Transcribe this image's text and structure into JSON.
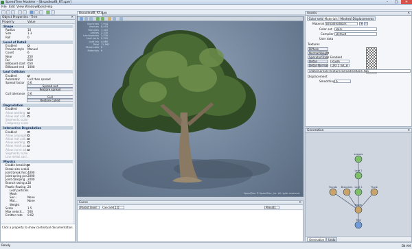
{
  "window": {
    "title": "SpeedTree Modeler - [BroadleafB_RT.spm]"
  },
  "menu": [
    "File",
    "Edit",
    "View",
    "Windows",
    "Tools",
    "Help"
  ],
  "object_properties": {
    "title": "Object Properties - Tree",
    "columns": [
      "Property",
      "Value"
    ],
    "rows": [
      {
        "type": "section",
        "name": "Shape"
      },
      {
        "name": "Radius",
        "value": "10"
      },
      {
        "name": "Size",
        "value": "1.3"
      },
      {
        "name": "Roll",
        "value": "0"
      },
      {
        "type": "gap"
      },
      {
        "type": "section",
        "name": "Level of Detail"
      },
      {
        "name": "Enabled",
        "check": true
      },
      {
        "name": "Preview style",
        "value": "Manual"
      },
      {
        "name": "Count",
        "value": "6"
      },
      {
        "name": "Near",
        "value": "250"
      },
      {
        "name": "Far",
        "value": "650"
      },
      {
        "name": "Billboard start",
        "value": "650"
      },
      {
        "name": "Billboard end",
        "value": "1000"
      },
      {
        "type": "gap"
      },
      {
        "type": "section",
        "name": "Leaf Collision"
      },
      {
        "name": "Enabled",
        "check": true
      },
      {
        "name": "Automatic",
        "value": "Cull then spread"
      },
      {
        "name": "Spread factor",
        "value": "0.6"
      },
      {
        "type": "button",
        "label": "Spread out"
      },
      {
        "type": "button",
        "label": "Restore spread"
      },
      {
        "name": "Cull tolerance",
        "value": "0.6"
      },
      {
        "type": "button",
        "label": "Cull"
      },
      {
        "type": "button",
        "label": "Restore culled"
      },
      {
        "type": "gap"
      },
      {
        "type": "section",
        "name": "Degradation"
      },
      {
        "name": "Enabled",
        "check": true
      },
      {
        "name": "Allow welding",
        "check": true,
        "disabled": true
      },
      {
        "name": "Allow leaf coll...",
        "check": true,
        "disabled": true
      },
      {
        "name": "Segments scale",
        "disabled": true
      },
      {
        "name": "Frequency scale",
        "disabled": true
      },
      {
        "type": "gap"
      },
      {
        "type": "section",
        "name": "Interactive Degradation"
      },
      {
        "name": "Enabled",
        "check": true
      },
      {
        "name": "Allow propagati...",
        "check": true,
        "disabled": true
      },
      {
        "name": "Allow leaf colli...",
        "check": true,
        "disabled": true
      },
      {
        "name": "Allow welding",
        "check": true,
        "disabled": true
      },
      {
        "name": "Allow mesh po...",
        "check": true,
        "disabled": true
      },
      {
        "name": "Allow curve ad...",
        "check": true,
        "disabled": true
      },
      {
        "name": "Segments scale",
        "disabled": true
      },
      {
        "name": "Line detail sacl...",
        "disabled": true
      },
      {
        "type": "gap"
      },
      {
        "type": "section",
        "name": "Physics"
      },
      {
        "name": "Enable breaking",
        "check": true
      },
      {
        "name": "Break size scale",
        "value": "1"
      },
      {
        "name": "Joint break forc...",
        "value": "4000"
      },
      {
        "name": "Joint spring per...",
        "value": "2000"
      },
      {
        "name": "Joint damping ...",
        "value": "2000"
      },
      {
        "name": "Branch swing a...",
        "value": "30"
      },
      {
        "name": "Plastic flowing ...",
        "value": "20"
      },
      {
        "name": "Leaf particles",
        "sub": true
      },
      {
        "name": "Mesh",
        "sub": true
      },
      {
        "name": "Sec...",
        "value": "None",
        "sub": true
      },
      {
        "name": "Mat...",
        "value": "None",
        "sub": true
      },
      {
        "name": "Weight",
        "sub": true
      },
      {
        "name": "Scale",
        "value": "1.5"
      },
      {
        "name": "Max velocit...",
        "value": "500"
      },
      {
        "name": "Emitter rate",
        "value": "0.02"
      }
    ],
    "help_text": "Click a property to show contextual documentation."
  },
  "viewport": {
    "tab": "BroadleafB_RT.spm",
    "stats": [
      {
        "k": "Branches",
        "v": "7,944"
      },
      {
        "k": "Vertices",
        "v": "8,493"
      },
      {
        "k": "Triangles",
        "v": "7,302"
      },
      {
        "k": "Leaves",
        "v": "2,330"
      },
      {
        "k": "Leaf meshes",
        "v": "2,330"
      },
      {
        "k": "Leaf verts",
        "v": "9,320"
      },
      {
        "k": "Leaf tris",
        "v": "4,660"
      },
      {
        "k": "Total",
        "v": "11,962"
      },
      {
        "k": "Draw calls",
        "v": "8"
      },
      {
        "k": "Materials",
        "v": "6"
      }
    ],
    "footer": "SpeedTree © SpeedTree, Inc. All rights reserved."
  },
  "curve": {
    "title": "Curve",
    "parent_level": "Parent level",
    "cascade_label": "Cascade",
    "cascade_value": "1.0",
    "presets_label": "Presets"
  },
  "assets": {
    "title": "Assets",
    "tabs": [
      "Color sets",
      "Materials",
      "Meshes",
      "Displacements"
    ],
    "material_label": "Material",
    "material_value": "BroadleafBark",
    "color_set_label": "Color set",
    "color_set_value": "Bark",
    "compiler_label": "Compiler",
    "compiler_value": "Default",
    "user_data_label": "User data",
    "textures_label": "Textures",
    "texture_slots": [
      "Diffuse",
      "Normal/Height",
      "Specular/Trans",
      "Detail",
      "Detail Normal"
    ],
    "enabled_label": "Enabled",
    "channel_value": "RGBA",
    "compression_value": "DXT5 (BC3)",
    "texture_path": "sdata\\Sample\\Textures\\BroadleafBark.tga",
    "displacement_label": "Displacement",
    "smoothing_label": "Smoothing",
    "smoothing_value": "6"
  },
  "generation": {
    "title": "Generation",
    "tabs": [
      "Generation",
      "Undo"
    ],
    "nodes": [
      "Leaves",
      "Leaf 2",
      "Fronds",
      "Branches",
      "Leaf 1",
      "Trunk",
      "Roots",
      "Tree"
    ]
  },
  "status": {
    "text": "Ready",
    "tray": "EN  AM"
  }
}
